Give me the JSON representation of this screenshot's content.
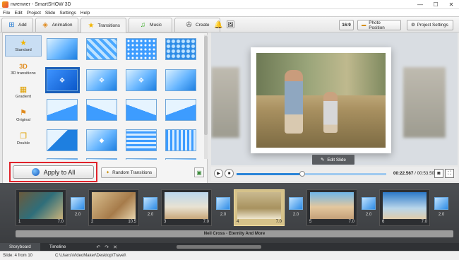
{
  "window": {
    "title": "nwenwer - SmartSHOW 3D",
    "controls": [
      "—",
      "☐",
      "✕"
    ]
  },
  "menu": [
    "File",
    "Edit",
    "Project",
    "Slide",
    "Settings",
    "Help"
  ],
  "tabs": [
    {
      "label": "Add",
      "icon": "add-icon"
    },
    {
      "label": "Animation",
      "icon": "animation-icon"
    },
    {
      "label": "Transitions",
      "icon": "star-icon"
    },
    {
      "label": "Music",
      "icon": "music-icon"
    },
    {
      "label": "Create",
      "icon": "film-reel-icon"
    }
  ],
  "toolbar": {
    "aspect": "16:9",
    "photo_position": "Photo Position",
    "project_settings": "Project Settings"
  },
  "categories": [
    "Standard",
    "3D transitions",
    "Gradient",
    "Original",
    "Double"
  ],
  "apply_all": "Apply to All",
  "random_transitions": "Random Transitions",
  "edit_slide": "Edit Slide",
  "player": {
    "current": "00:22.567",
    "total": "00:53.500",
    "progress": 0.44
  },
  "storyboard": {
    "slides": [
      {
        "num": "1",
        "dur": "7.0",
        "selected": false
      },
      {
        "num": "2",
        "dur": "10.5",
        "selected": false
      },
      {
        "num": "3",
        "dur": "7.0",
        "selected": false
      },
      {
        "num": "4",
        "dur": "7.0",
        "selected": true
      },
      {
        "num": "5",
        "dur": "7.0",
        "selected": false
      },
      {
        "num": "6",
        "dur": "7.0",
        "selected": false
      }
    ],
    "transitions": [
      "2.0",
      "2.0",
      "2.0",
      "2.0",
      "2.0",
      "2.0"
    ],
    "music": "Neil Cross - Eternity And More"
  },
  "bottom_tabs": [
    "Storyboard",
    "Timeline"
  ],
  "status": {
    "slide": "Slide: 4 from 10",
    "path": "C:\\Users\\VideoMaker\\Desktop\\Travel\\"
  }
}
